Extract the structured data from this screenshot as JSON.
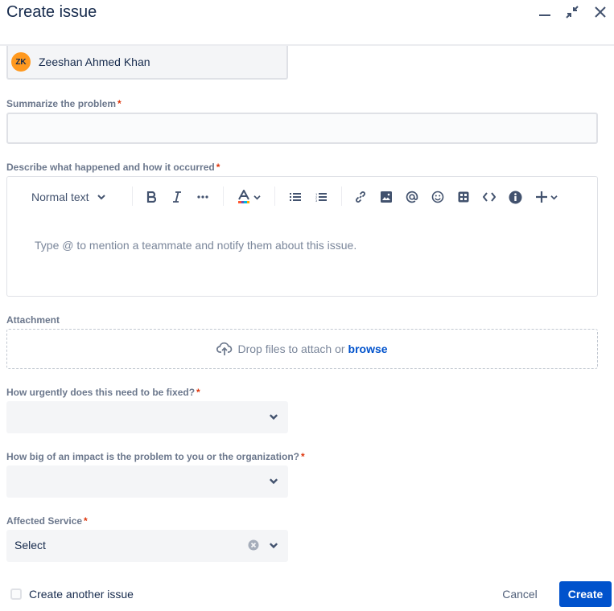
{
  "dialog": {
    "title": "Create issue",
    "icons": [
      "minimize-icon",
      "collapse-icon",
      "close-icon"
    ]
  },
  "reporter": {
    "initials": "ZK",
    "name": "Zeeshan Ahmed Khan",
    "avatar_color": "#ff991f"
  },
  "fields": {
    "summary": {
      "label": "Summarize the problem",
      "required_mark": "*",
      "value": "",
      "placeholder": ""
    },
    "description": {
      "label": "Describe what happened and how it occurred",
      "required_mark": "*",
      "placeholder": "Type @ to mention a teammate and notify them about this issue.",
      "toolbar": {
        "text_style": "Normal text",
        "buttons": [
          "bold",
          "italic",
          "more-formatting",
          "text-color",
          "bullet-list",
          "numbered-list",
          "link",
          "image",
          "mention",
          "emoji",
          "table",
          "code",
          "info-panel",
          "insert"
        ]
      }
    },
    "attachment": {
      "label": "Attachment",
      "drop_text": "Drop files to attach or",
      "browse_label": "browse"
    },
    "urgency": {
      "label": "How urgently does this need to be fixed?",
      "required_mark": "*",
      "value": ""
    },
    "impact": {
      "label": "How big of an impact is the problem to you or the organization?",
      "required_mark": "*",
      "value": ""
    },
    "affected_service": {
      "label": "Affected Service",
      "required_mark": "*",
      "value": "Select"
    }
  },
  "footer": {
    "create_another_label": "Create another issue",
    "create_another_checked": false,
    "cancel_label": "Cancel",
    "create_label": "Create"
  },
  "colors": {
    "primary": "#0052cc",
    "required": "#de350b",
    "text": "#172b4d",
    "label": "#6b778c"
  }
}
